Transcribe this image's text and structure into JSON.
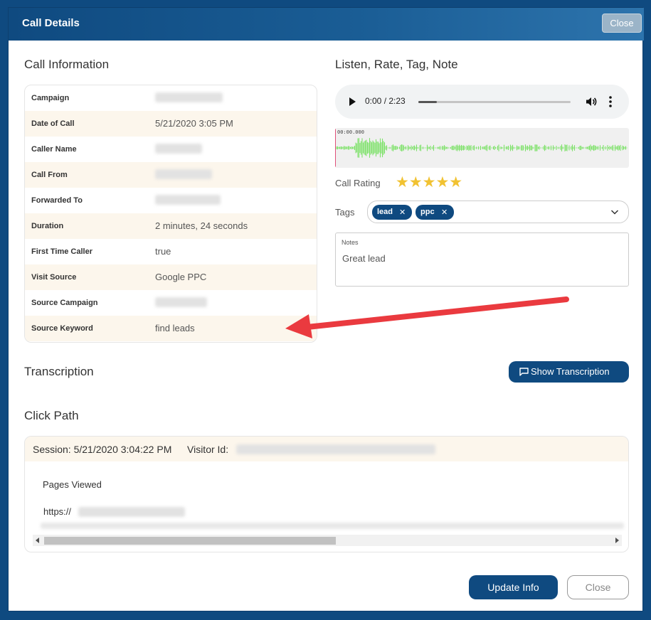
{
  "modal": {
    "title": "Call Details",
    "close_label": "Close"
  },
  "call_info": {
    "title": "Call Information",
    "rows": [
      {
        "label": "Campaign",
        "value": ""
      },
      {
        "label": "Date of Call",
        "value": "5/21/2020 3:05 PM"
      },
      {
        "label": "Caller Name",
        "value": ""
      },
      {
        "label": "Call From",
        "value": ""
      },
      {
        "label": "Forwarded To",
        "value": ""
      },
      {
        "label": "Duration",
        "value": "2 minutes, 24 seconds"
      },
      {
        "label": "First Time Caller",
        "value": "true"
      },
      {
        "label": "Visit Source",
        "value": "Google PPC"
      },
      {
        "label": "Source Campaign",
        "value": ""
      },
      {
        "label": "Source Keyword",
        "value": "find leads"
      }
    ]
  },
  "listen": {
    "title": "Listen, Rate, Tag, Note",
    "audio_time": "0:00 / 2:23",
    "audio_progress": 0.12,
    "waveform_time": "00:00.000",
    "rating_label": "Call Rating",
    "rating_stars": "★★★★★",
    "rating_value": 5,
    "tags_label": "Tags",
    "tags": [
      "lead",
      "ppc"
    ],
    "notes_label": "Notes",
    "notes_value": "Great lead"
  },
  "transcription": {
    "title": "Transcription",
    "button_label": "Show Transcription"
  },
  "click_path": {
    "title": "Click Path",
    "session_label": "Session: 5/21/2020 3:04:22 PM",
    "visitor_label": "Visitor Id:",
    "pages_viewed_label": "Pages Viewed",
    "url_prefix": "https://"
  },
  "footer": {
    "update_label": "Update Info",
    "close_label": "Close"
  },
  "colors": {
    "primary": "#0f4a80",
    "row_alt": "#fcf6ec",
    "star": "#f1c232",
    "waveform": "#7ee26a",
    "annotation_arrow": "#ea3a3f"
  }
}
